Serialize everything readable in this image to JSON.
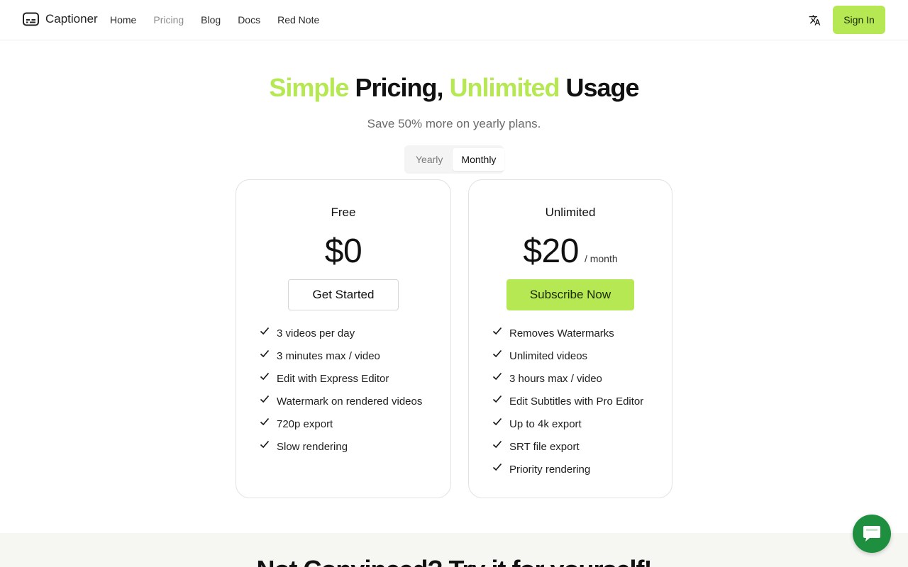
{
  "brand": {
    "name": "Captioner",
    "logo_icon": "subtitles-icon"
  },
  "nav": {
    "items": [
      {
        "label": "Home",
        "active": false
      },
      {
        "label": "Pricing",
        "active": true
      },
      {
        "label": "Blog",
        "active": false
      },
      {
        "label": "Docs",
        "active": false
      },
      {
        "label": "Red Note",
        "active": false
      }
    ]
  },
  "header": {
    "translate_icon": "translate-icon",
    "signin_label": "Sign In"
  },
  "hero": {
    "title_parts": [
      "Simple",
      " Pricing, ",
      "Unlimited",
      " Usage"
    ],
    "subtitle": "Save 50% more on yearly plans.",
    "billing_options": [
      "Yearly",
      "Monthly"
    ],
    "selected_billing": "Monthly"
  },
  "plans": [
    {
      "name": "Free",
      "price": "$0",
      "period": "",
      "cta": "Get Started",
      "features": [
        "3 videos per day",
        "3 minutes max / video",
        "Edit with Express Editor",
        "Watermark on rendered videos",
        "720p export",
        "Slow rendering"
      ]
    },
    {
      "name": "Unlimited",
      "price": "$20",
      "period": "/ month",
      "cta": "Subscribe Now",
      "features": [
        "Removes Watermarks",
        "Unlimited videos",
        "3 hours max / video",
        "Edit Subtitles with Pro Editor",
        "Up to 4k export",
        "SRT file export",
        "Priority rendering"
      ]
    }
  ],
  "bottom": {
    "title": "Not Convinced? Try it for yourself!"
  },
  "chat": {
    "icon": "chat-icon"
  },
  "colors": {
    "accent": "#b5e853",
    "chat": "#1e8f3e"
  }
}
